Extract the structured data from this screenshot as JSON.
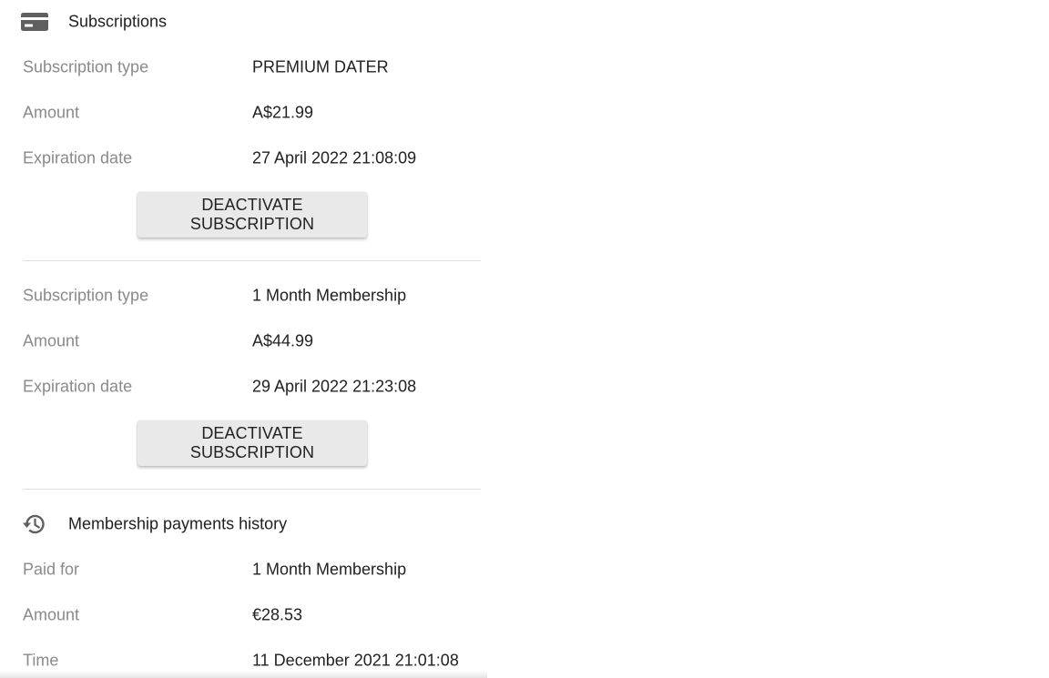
{
  "subscriptions_section": {
    "title": "Subscriptions",
    "icon": "credit-card-icon",
    "items": [
      {
        "rows": [
          {
            "label": "Subscription type",
            "value": "PREMIUM DATER"
          },
          {
            "label": "Amount",
            "value": "A$21.99"
          },
          {
            "label": "Expiration date",
            "value": "27 April 2022 21:08:09"
          }
        ],
        "button_label": "DEACTIVATE SUBSCRIPTION"
      },
      {
        "rows": [
          {
            "label": "Subscription type",
            "value": "1 Month Membership"
          },
          {
            "label": "Amount",
            "value": "A$44.99"
          },
          {
            "label": "Expiration date",
            "value": "29 April 2022 21:23:08"
          }
        ],
        "button_label": "DEACTIVATE SUBSCRIPTION"
      }
    ]
  },
  "payments_history_section": {
    "title": "Membership payments history",
    "icon": "history-icon",
    "items": [
      {
        "rows": [
          {
            "label": "Paid for",
            "value": "1 Month Membership"
          },
          {
            "label": "Amount",
            "value": "€28.53"
          },
          {
            "label": "Time",
            "value": "11 December 2021 21:01:08"
          }
        ]
      }
    ]
  },
  "colors": {
    "label_text": "#8a8a8a",
    "value_text": "#222222",
    "button_bg": "#e9e9e9",
    "icon": "#5f5f5f",
    "divider": "#e0e0e0"
  }
}
